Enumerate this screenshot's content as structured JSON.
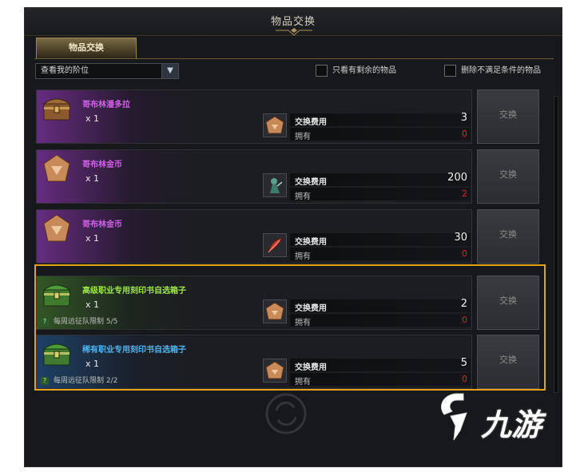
{
  "window": {
    "title": "物品交换"
  },
  "tabs": [
    {
      "label": "物品交换",
      "active": true
    }
  ],
  "filter": {
    "dropdown_value": "查看我的阶位",
    "checkbox_remaining": "只看有剩余的物品",
    "checkbox_exclude": "删除不满足条件的物品"
  },
  "labels": {
    "cost": "交换费用",
    "owned": "拥有",
    "exchange": "交换"
  },
  "rows": [
    {
      "name": "哥布林潘多拉",
      "name_color": "#d060e8",
      "quantity": "x 1",
      "cost": "3",
      "owned": "0",
      "icon": "treasure-chest-icon",
      "cost_icon": "goblin-coin-icon",
      "limit": ""
    },
    {
      "name": "哥布林金币",
      "name_color": "#d060e8",
      "quantity": "x 1",
      "cost": "200",
      "owned": "2",
      "icon": "goblin-coin-icon",
      "cost_icon": "goblin-figure-icon",
      "limit": ""
    },
    {
      "name": "哥布林金币",
      "name_color": "#d060e8",
      "quantity": "x 1",
      "cost": "30",
      "owned": "0",
      "icon": "goblin-coin-icon",
      "cost_icon": "red-feather-icon",
      "limit": ""
    },
    {
      "name": "高级职业专用刻印书自选箱子",
      "name_color": "#9ee84a",
      "quantity": "x 1",
      "cost": "2",
      "owned": "0",
      "icon": "green-chest-icon",
      "cost_icon": "goblin-coin-icon",
      "limit": "每周远征队限制 5/5"
    },
    {
      "name": "稀有职业专用刻印书自选箱子",
      "name_color": "#4fb4f0",
      "quantity": "x 1",
      "cost": "5",
      "owned": "0",
      "icon": "green-chest-icon",
      "cost_icon": "goblin-coin-icon",
      "limit": "每周远征队限制 2/2"
    }
  ],
  "watermark": {
    "text": "九游"
  },
  "colors": {
    "accent_gold": "#e2a316",
    "owned_red": "#e02424"
  }
}
